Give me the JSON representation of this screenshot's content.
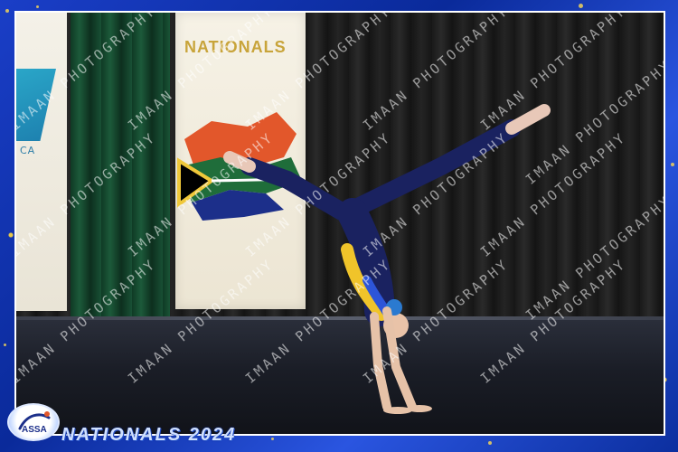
{
  "frame": {
    "border_color": "#1a3ec7",
    "glitter_color": "#e9c94a"
  },
  "backdrop": {
    "left_banner_text": "CA",
    "main_banner_text": "NATIONALS",
    "flag_colors": [
      "#e2572b",
      "#1f6d3a",
      "#1c2f8a",
      "#f0c83a",
      "#ffffff",
      "#000000"
    ]
  },
  "watermark": {
    "text": "IMAAN PHOTOGRAPHY"
  },
  "footer": {
    "logo_text": "ASSA",
    "logo_icon": "gymnast-logo-icon",
    "event_title": "NATIONALS 2024"
  }
}
